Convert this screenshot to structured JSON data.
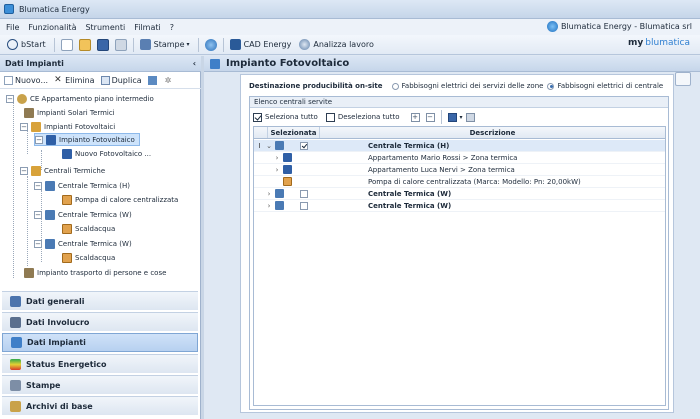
{
  "window": {
    "title": "Blumatica Energy",
    "brand_right": "Blumatica Energy - Blumatica srl"
  },
  "menu": [
    "File",
    "Funzionalità",
    "Strumenti",
    "Filmati",
    "?"
  ],
  "toolbar": {
    "start_label": "bStart",
    "stampe_label": "Stampe",
    "cad_label": "CAD Energy",
    "analizza_label": "Analizza lavoro"
  },
  "logo": {
    "my": "my",
    "name": "blumatica"
  },
  "left_panel": {
    "title": "Dati Impianti",
    "pin": "‹",
    "tools": {
      "new_label": "Nuovo...",
      "delete_label": "Elimina",
      "duplicate_label": "Duplica"
    },
    "tree": [
      {
        "label": "CE Appartamento piano intermedio",
        "selected": false
      },
      {
        "label": "Impianti Solari Termici",
        "selected": false
      },
      {
        "label": "Impianti Fotovoltaici",
        "selected": false
      },
      {
        "label": "Impianto Fotovoltaico",
        "selected": true
      },
      {
        "label": "Nuovo Fotovoltaico ...",
        "selected": false
      },
      {
        "label": "Centrali Termiche",
        "selected": false
      },
      {
        "label": "Centrale Termica (H)",
        "selected": false
      },
      {
        "label": "Pompa di calore centralizzata",
        "selected": false
      },
      {
        "label": "Centrale Termica (W)",
        "selected": false
      },
      {
        "label": "Scaldacqua",
        "selected": false
      },
      {
        "label": "Centrale Termica (W)",
        "selected": false
      },
      {
        "label": "Scaldacqua",
        "selected": false
      },
      {
        "label": "Impianto trasporto di persone e cose",
        "selected": false
      }
    ],
    "nav": [
      {
        "label": "Dati generali",
        "active": false
      },
      {
        "label": "Dati Involucro",
        "active": false
      },
      {
        "label": "Dati Impianti",
        "active": true
      },
      {
        "label": "Status Energetico",
        "active": false
      },
      {
        "label": "Stampe",
        "active": false
      },
      {
        "label": "Archivi di base",
        "active": false
      }
    ]
  },
  "main": {
    "title": "Impianto Fotovoltaico",
    "dest_label": "Destinazione producibilità on-site",
    "option_1": "Fabbisogni elettrici dei servizi delle zone",
    "option_2": "Fabbisogni elettrici di centrale",
    "option_selected": 2,
    "group_title": "Elenco centrali servite",
    "select_all": "Seleziona tutto",
    "deselect_all": "Deseleziona tutto",
    "columns": [
      "Selezionata",
      "Descrizione"
    ],
    "rows": [
      {
        "indicator": "I",
        "expander": "⌄",
        "checked": true,
        "text": "Centrale Termica (H)",
        "bold": true,
        "level": 0
      },
      {
        "indicator": "",
        "expander": "›",
        "checked": null,
        "text": "Appartamento Mario Rossi > Zona termica",
        "bold": false,
        "level": 1
      },
      {
        "indicator": "",
        "expander": "›",
        "checked": null,
        "text": "Appartamento Luca Nervi > Zona termica",
        "bold": false,
        "level": 1
      },
      {
        "indicator": "",
        "expander": "",
        "checked": null,
        "text": "Pompa di calore centralizzata (Marca:  Modello:  Pn: 20,00kW)",
        "bold": false,
        "level": 1
      },
      {
        "indicator": "",
        "expander": "›",
        "checked": false,
        "text": "Centrale Termica (W)",
        "bold": true,
        "level": 0
      },
      {
        "indicator": "",
        "expander": "›",
        "checked": false,
        "text": "Centrale Termica (W)",
        "bold": true,
        "level": 0
      }
    ]
  },
  "colors": {
    "accent": "#3f7fc8",
    "selection": "#cde3fb",
    "header": "#c6d6ea"
  }
}
